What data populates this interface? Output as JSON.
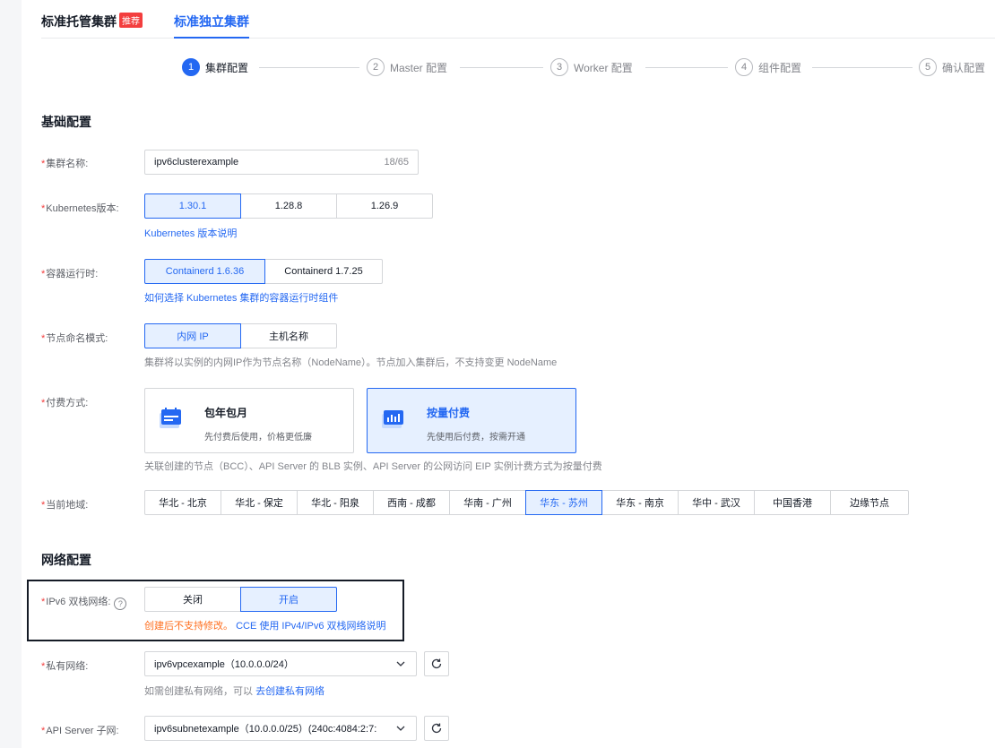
{
  "tabs": {
    "managed": "标准托管集群",
    "managed_badge": "推荐",
    "standalone": "标准独立集群"
  },
  "steps": [
    {
      "num": "1",
      "label": "集群配置"
    },
    {
      "num": "2",
      "label": "Master 配置"
    },
    {
      "num": "3",
      "label": "Worker 配置"
    },
    {
      "num": "4",
      "label": "组件配置"
    },
    {
      "num": "5",
      "label": "确认配置"
    }
  ],
  "basic": {
    "title": "基础配置",
    "cluster_name": {
      "label": "集群名称:",
      "value": "ipv6clusterexample",
      "count": "18/65"
    },
    "k8s_version": {
      "label": "Kubernetes版本:",
      "options": [
        "1.30.1",
        "1.28.8",
        "1.26.9"
      ],
      "selected": "1.30.1",
      "link": "Kubernetes 版本说明"
    },
    "runtime": {
      "label": "容器运行时:",
      "options": [
        "Containerd 1.6.36",
        "Containerd 1.7.25"
      ],
      "selected": "Containerd 1.6.36",
      "link": "如何选择 Kubernetes 集群的容器运行时组件"
    },
    "naming": {
      "label": "节点命名模式:",
      "options": [
        "内网 IP",
        "主机名称"
      ],
      "selected": "内网 IP",
      "hint": "集群将以实例的内网IP作为节点名称（NodeName）。节点加入集群后，不支持变更 NodeName"
    },
    "billing": {
      "label": "付费方式:",
      "prepaid": {
        "title": "包年包月",
        "desc": "先付费后使用，价格更低廉"
      },
      "postpaid": {
        "title": "按量付费",
        "desc": "先使用后付费，按需开通"
      },
      "hint": "关联创建的节点（BCC）、API Server 的 BLB 实例、API Server 的公网访问 EIP 实例计费方式为按量付费"
    },
    "region": {
      "label": "当前地域:",
      "options": [
        "华北 - 北京",
        "华北 - 保定",
        "华北 - 阳泉",
        "西南 - 成都",
        "华南 - 广州",
        "华东 - 苏州",
        "华东 - 南京",
        "华中 - 武汉",
        "中国香港",
        "边缘节点"
      ],
      "selected": "华东 - 苏州"
    }
  },
  "network": {
    "title": "网络配置",
    "ipv6": {
      "label": "IPv6 双栈网络:",
      "help": "?",
      "options": [
        "关闭",
        "开启"
      ],
      "selected": "开启",
      "warn": "创建后不支持修改。",
      "link": "CCE 使用 IPv4/IPv6 双栈网络说明"
    },
    "vpc": {
      "label": "私有网络:",
      "value": "ipv6vpcexample（10.0.0.0/24）",
      "hint": "如需创建私有网络，可以",
      "link": "去创建私有网络"
    },
    "subnet": {
      "label": "API Server 子网:",
      "value": "ipv6subnetexample（10.0.0.0/25）(240c:4084:2:7:"
    }
  },
  "colors": {
    "accent": "#2468f2",
    "required": "#f33e3e",
    "warning": "#ff6f1f"
  }
}
